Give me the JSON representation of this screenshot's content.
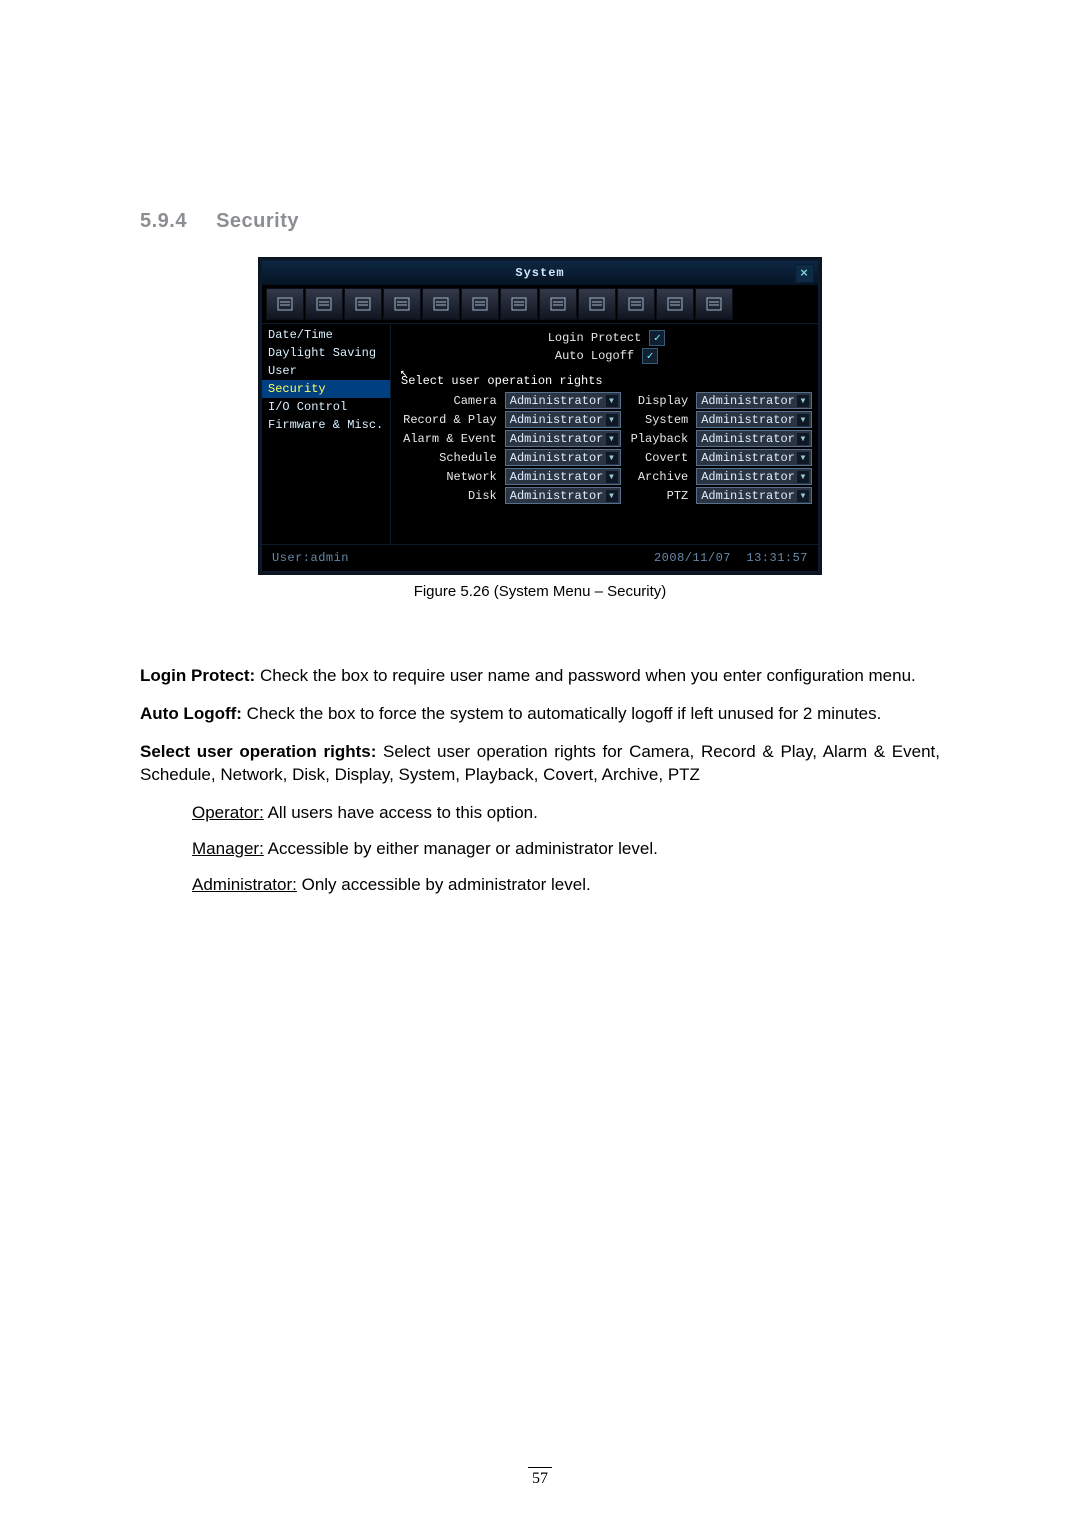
{
  "section": {
    "number": "5.9.4",
    "title": "Security"
  },
  "ui": {
    "title": "System",
    "close": "×",
    "toolbar_icons": [
      "calendar-icon",
      "brush-icon",
      "drive-icon",
      "user-icon",
      "sliders-icon",
      "camera-icon",
      "monitor-icon",
      "globe-icon",
      "info-icon",
      "clipboard-icon",
      "search-icon",
      "wrench-icon"
    ],
    "side": [
      {
        "label": "Date/Time"
      },
      {
        "label": "Daylight Saving"
      },
      {
        "label": "User"
      },
      {
        "label": "Security"
      },
      {
        "label": "I/O Control"
      },
      {
        "label": "Firmware & Misc."
      }
    ],
    "login_protect": {
      "label": "Login Protect",
      "checked": true
    },
    "auto_logoff": {
      "label": "Auto Logoff",
      "checked": true
    },
    "group_label": "Select user operation rights",
    "rights": [
      {
        "name": "Camera",
        "value": "Administrator"
      },
      {
        "name": "Display",
        "value": "Administrator"
      },
      {
        "name": "Record & Play",
        "value": "Administrator"
      },
      {
        "name": "System",
        "value": "Administrator"
      },
      {
        "name": "Alarm & Event",
        "value": "Administrator"
      },
      {
        "name": "Playback",
        "value": "Administrator"
      },
      {
        "name": "Schedule",
        "value": "Administrator"
      },
      {
        "name": "Covert",
        "value": "Administrator"
      },
      {
        "name": "Network",
        "value": "Administrator"
      },
      {
        "name": "Archive",
        "value": "Administrator"
      },
      {
        "name": "Disk",
        "value": "Administrator"
      },
      {
        "name": "PTZ",
        "value": "Administrator"
      }
    ],
    "status": {
      "user": "User:admin",
      "date": "2008/11/07",
      "time": "13:31:57"
    }
  },
  "caption": "Figure 5.26 (System Menu – Security)",
  "text": {
    "p1a": "Login Protect:",
    "p1b": " Check the box to require user name and password when you enter configuration menu.",
    "p2a": "Auto Logoff:",
    "p2b": " Check the box to force the system to automatically logoff if left unused for 2 minutes.",
    "p3a": "Select user operation rights:",
    "p3b": " Select user operation rights for Camera, Record & Play, Alarm & Event, Schedule, Network, Disk, Display, System, Playback, Covert, Archive, PTZ",
    "op1a": "Operator:",
    "op1b": " All users have access to this option.",
    "op2a": "Manager:",
    "op2b": " Accessible by either manager or administrator level.",
    "op3a": "Administrator:",
    "op3b": " Only accessible by administrator level."
  },
  "page_number": "57"
}
